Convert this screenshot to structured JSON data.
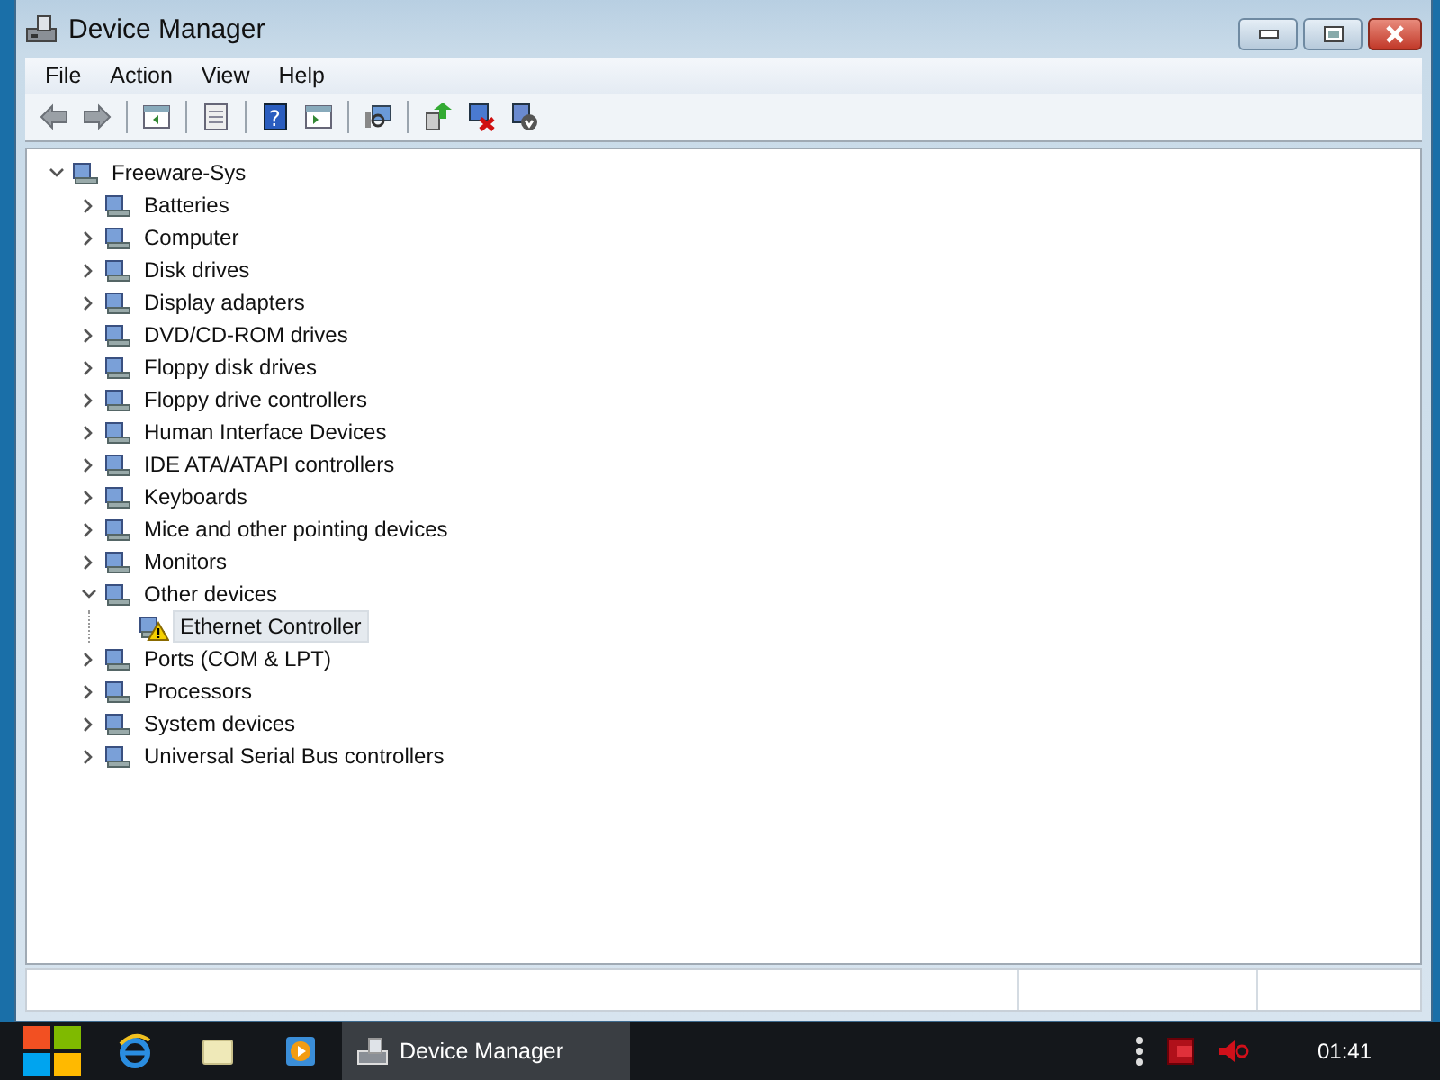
{
  "window": {
    "title": "Device Manager"
  },
  "menu": [
    {
      "label": "File"
    },
    {
      "label": "Action"
    },
    {
      "label": "View"
    },
    {
      "label": "Help"
    }
  ],
  "tree": [
    {
      "label": "Freeware-Sys",
      "expanded": true,
      "selected": false,
      "children": [
        {
          "label": "Batteries",
          "expanded": false,
          "selected": false
        },
        {
          "label": "Computer",
          "expanded": false,
          "selected": false
        },
        {
          "label": "Disk drives",
          "expanded": false,
          "selected": false
        },
        {
          "label": "Display adapters",
          "expanded": false,
          "selected": false
        },
        {
          "label": "DVD/CD-ROM drives",
          "expanded": false,
          "selected": false
        },
        {
          "label": "Floppy disk drives",
          "expanded": false,
          "selected": false
        },
        {
          "label": "Floppy drive controllers",
          "expanded": false,
          "selected": false
        },
        {
          "label": "Human Interface Devices",
          "expanded": false,
          "selected": false
        },
        {
          "label": "IDE ATA/ATAPI controllers",
          "expanded": false,
          "selected": false
        },
        {
          "label": "Keyboards",
          "expanded": false,
          "selected": false
        },
        {
          "label": "Mice and other pointing devices",
          "expanded": false,
          "selected": false
        },
        {
          "label": "Monitors",
          "expanded": false,
          "selected": false
        },
        {
          "label": "Other devices",
          "expanded": true,
          "selected": false,
          "children": [
            {
              "label": "Ethernet Controller",
              "selected": true,
              "warning": true
            }
          ]
        },
        {
          "label": "Ports (COM & LPT)",
          "expanded": false,
          "selected": false
        },
        {
          "label": "Processors",
          "expanded": false,
          "selected": false
        },
        {
          "label": "System devices",
          "expanded": false,
          "selected": false
        },
        {
          "label": "Universal Serial Bus controllers",
          "expanded": false,
          "selected": false
        }
      ]
    }
  ],
  "toolbar": {
    "help_glyph": "?"
  },
  "taskbar": {
    "tasks": [
      {
        "label": "Device Manager",
        "active": true
      }
    ],
    "clock": "01:41"
  }
}
